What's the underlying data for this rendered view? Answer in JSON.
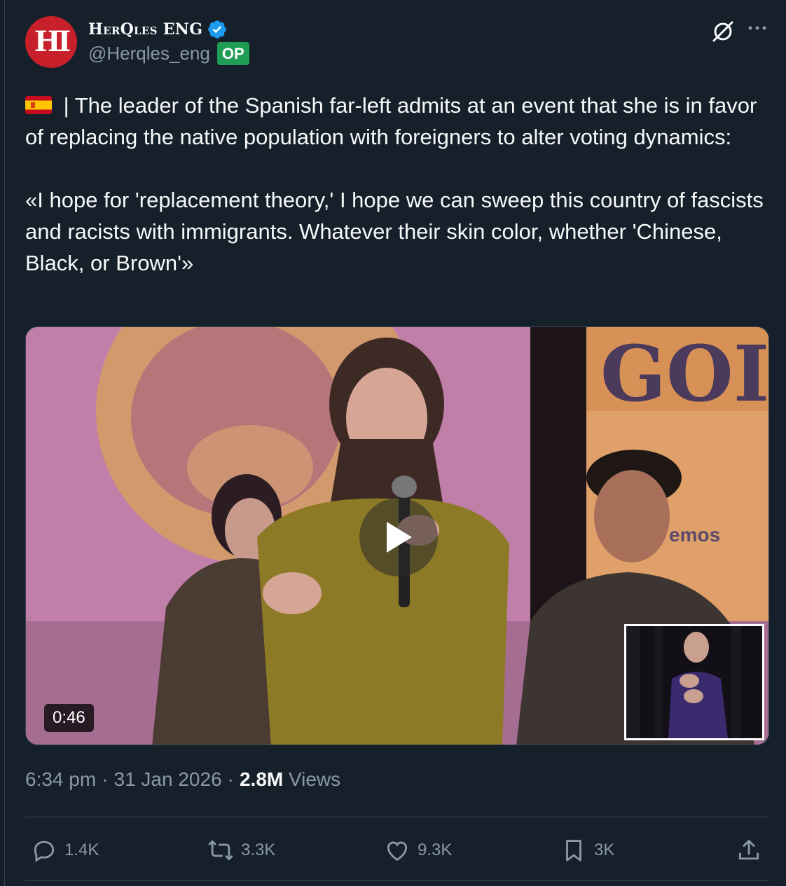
{
  "author": {
    "display_name": "HerQles ENG",
    "handle": "@Herqles_eng",
    "badge": "OP",
    "avatar_letters": "HI",
    "avatar_color": "#c8202a",
    "verified_color": "#1d9bf0"
  },
  "tweet": {
    "flag_icon": "spain-flag-icon",
    "text_line_1": " | The leader of the Spanish far-left admits at an event that she is in favor of replacing the native population with foreigners to alter voting dynamics:",
    "text_quote": "«I hope for 'replacement theory,' I hope we can sweep this country of fascists and racists with immigrants. Whatever their skin color, whether 'Chinese, Black, or Brown'»"
  },
  "video": {
    "duration": "0:46",
    "banner_text": "GOI",
    "banner_text_2": "emos"
  },
  "meta": {
    "time": "6:34 pm",
    "separator": "·",
    "date": "31 Jan 2026",
    "views_count": "2.8M",
    "views_label": "Views"
  },
  "actions": {
    "replies": "1.4K",
    "reposts": "3.3K",
    "likes": "9.3K",
    "bookmarks": "3K"
  },
  "colors": {
    "background": "#15202b",
    "text": "#f7f9f9",
    "secondary": "#8b98a5",
    "op_badge": "#1f9d55"
  }
}
